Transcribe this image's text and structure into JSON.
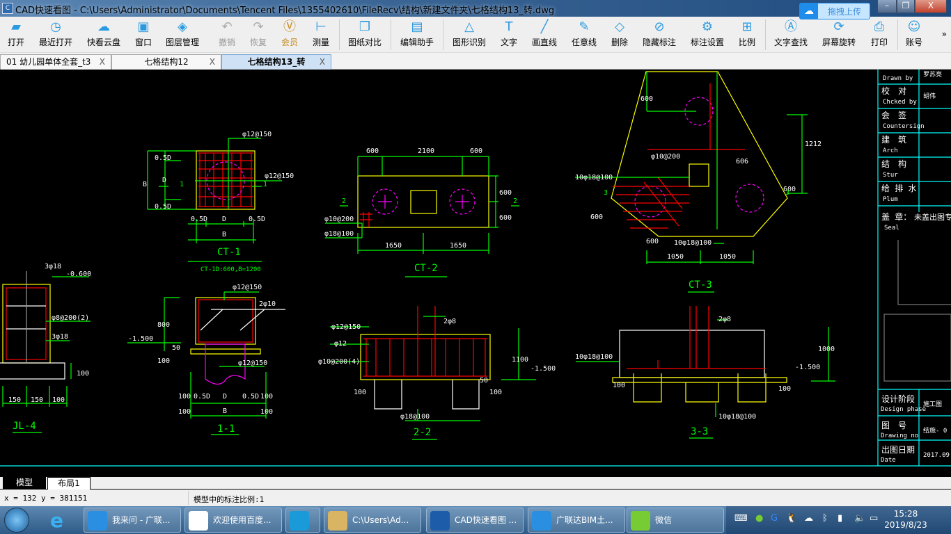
{
  "window": {
    "title": "CAD快速看图 - C:\\Users\\Administrator\\Documents\\Tencent Files\\1355402610\\FileRecv\\结构\\新建文件夹\\七格结构13_转.dwg",
    "upload_label": "拖拽上传",
    "minimize": "–",
    "restore": "❐",
    "close": "X"
  },
  "toolbar": {
    "items": [
      {
        "label": "打开",
        "icon": "folder-icon"
      },
      {
        "label": "最近打开",
        "icon": "clock-icon"
      },
      {
        "label": "快看云盘",
        "icon": "cloud-icon"
      },
      {
        "label": "窗口",
        "icon": "window-icon"
      },
      {
        "label": "图层管理",
        "icon": "layers-icon"
      },
      {
        "label": "撤销",
        "icon": "undo-icon"
      },
      {
        "label": "恢复",
        "icon": "redo-icon"
      },
      {
        "label": "会员",
        "icon": "vip-icon"
      },
      {
        "label": "测量",
        "icon": "ruler-icon"
      },
      {
        "label": "图纸对比",
        "icon": "compare-icon"
      },
      {
        "label": "编辑助手",
        "icon": "edit-assistant-icon"
      },
      {
        "label": "图形识别",
        "icon": "shape-recognize-icon"
      },
      {
        "label": "文字",
        "icon": "text-icon"
      },
      {
        "label": "画直线",
        "icon": "line-icon"
      },
      {
        "label": "任意线",
        "icon": "pen-icon"
      },
      {
        "label": "删除",
        "icon": "eraser-icon"
      },
      {
        "label": "隐藏标注",
        "icon": "eye-hide-icon"
      },
      {
        "label": "标注设置",
        "icon": "annotation-settings-icon"
      },
      {
        "label": "比例",
        "icon": "scale-icon"
      },
      {
        "label": "文字查找",
        "icon": "text-search-icon"
      },
      {
        "label": "屏幕旋转",
        "icon": "rotate-screen-icon"
      },
      {
        "label": "打印",
        "icon": "printer-icon"
      },
      {
        "label": "账号",
        "icon": "user-icon"
      }
    ],
    "more": "»"
  },
  "tabs": [
    {
      "label": "01 幼儿园单体全套_t3",
      "close": "X"
    },
    {
      "label": "七格结构12",
      "close": "X"
    },
    {
      "label": "七格结构13_转",
      "close": "X",
      "active": true
    }
  ],
  "drawing": {
    "titles": [
      "CT-1",
      "CT-2",
      "CT-3",
      "JL-4",
      "1-1",
      "2-2",
      "3-3"
    ],
    "ct1_note": "CT-1D:600,B=1200",
    "labels": [
      "φ12@150",
      "φ12@150",
      "B",
      "D",
      "0.5D",
      "0.5D",
      "0.5D",
      "D",
      "0.5D",
      "B",
      "1",
      "1",
      "600",
      "2100",
      "600",
      "600",
      "600",
      "1650",
      "1650",
      "2",
      "2",
      "φ10@200",
      "φ18@100",
      "600",
      "1212",
      "600",
      "606",
      "600",
      "600",
      "1050",
      "1050",
      "10φ18@100",
      "10φ18@100",
      "φ10@200",
      "3",
      "3",
      "3φ18",
      "-0.600",
      "φ8@200(2)",
      "3φ18",
      "100",
      "150",
      "150",
      "100",
      "φ12@150",
      "2φ10",
      "800",
      "-1.500",
      "50",
      "100",
      "φ12@150",
      "100",
      "0.5D",
      "D",
      "0.5D",
      "100",
      "100",
      "B",
      "100",
      "φ12@150",
      "φ12",
      "φ10@200(4)",
      "2φ8",
      "1100",
      "-1.500",
      "100",
      "100",
      "φ18@100",
      "50",
      "2φ8",
      "10φ18@100",
      "1000",
      "-1.500",
      "100",
      "100",
      "10φ18@100"
    ],
    "colors": {
      "background": "#000000",
      "dimension": "#00ff00",
      "outline": "#ffff00",
      "rebar": "#ff0000",
      "pile": "#ff00ff",
      "titleblock": "#00ffff"
    }
  },
  "titleblock": {
    "rows": [
      {
        "cn": "",
        "en": "Drawn by",
        "value": "罗苏亮"
      },
      {
        "cn": "校　对",
        "en": "Chcked by",
        "value": "胡伟"
      },
      {
        "cn": "会　签",
        "en": "Countersign",
        "value": ""
      },
      {
        "cn": "建　筑",
        "en": "Arch",
        "value": ""
      },
      {
        "cn": "结　构",
        "en": "Stur",
        "value": ""
      },
      {
        "cn": "给 排 水",
        "en": "Plum",
        "value": ""
      }
    ],
    "seal_cn": "盖 章：",
    "seal_value": "未盖出图专",
    "seal_en": "Seal",
    "bottom": [
      {
        "cn": "设计阶段",
        "en": "Design phase",
        "value": "施工图"
      },
      {
        "cn": "图　号",
        "en": "Drawing no",
        "value": "结施- 0"
      },
      {
        "cn": "出图日期",
        "en": "Date",
        "value": "2017.09"
      }
    ]
  },
  "layout_tabs": [
    {
      "label": "模型",
      "active": true
    },
    {
      "label": "布局1"
    }
  ],
  "status": {
    "coords": "x = 132 y = 381151",
    "scale": "模型中的标注比例:1"
  },
  "taskbar": {
    "items": [
      {
        "label": "我来问 - 广联..."
      },
      {
        "label": "欢迎使用百度..."
      },
      {
        "label": ""
      },
      {
        "label": "C:\\Users\\Ad..."
      },
      {
        "label": "CAD快速看图 ..."
      },
      {
        "label": "广联达BIM土..."
      },
      {
        "label": "微信"
      }
    ],
    "time": "15:28",
    "date": "2019/8/23"
  }
}
